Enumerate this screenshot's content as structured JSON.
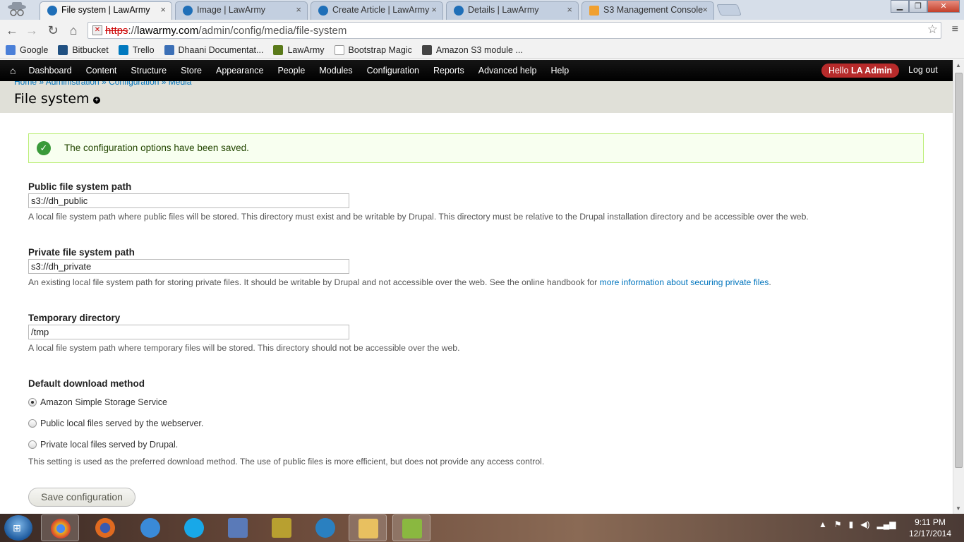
{
  "browser": {
    "tabs": [
      {
        "title": "File system | LawArmy",
        "active": true,
        "icon": "drupal-icon"
      },
      {
        "title": "Image | LawArmy",
        "active": false,
        "icon": "drupal-icon"
      },
      {
        "title": "Create Article | LawArmy",
        "active": false,
        "icon": "drupal-icon"
      },
      {
        "title": "Details | LawArmy",
        "active": false,
        "icon": "drupal-icon"
      },
      {
        "title": "S3 Management Console",
        "active": false,
        "icon": "aws-icon"
      }
    ],
    "close_glyph": "×",
    "window_buttons": {
      "minimize": "▁",
      "maximize": "❐",
      "close": "✕"
    },
    "nav": {
      "back": "←",
      "forward": "→",
      "reload": "↻",
      "home": "⌂",
      "star": "☆",
      "menu": "≡"
    },
    "url": {
      "warning_glyph": "✕",
      "scheme": "https",
      "rest_prefix": "://",
      "host": "lawarmy.com",
      "path": "/admin/config/media/file-system"
    },
    "bookmarks": [
      {
        "label": "Google",
        "icon": "google-icon",
        "color": "#4a7fd8"
      },
      {
        "label": "Bitbucket",
        "icon": "bitbucket-icon",
        "color": "#205081"
      },
      {
        "label": "Trello",
        "icon": "trello-icon",
        "color": "#0079bf"
      },
      {
        "label": "Dhaani Documentat...",
        "icon": "doc-icon",
        "color": "#3b6fb6"
      },
      {
        "label": "LawArmy",
        "icon": "lawarmy-icon",
        "color": "#5a7a1a"
      },
      {
        "label": "Bootstrap Magic",
        "icon": "page-icon",
        "color": "#dddddd"
      },
      {
        "label": "Amazon S3 module ...",
        "icon": "amazon-icon",
        "color": "#444444"
      }
    ]
  },
  "admin": {
    "home_glyph": "⌂",
    "menu": [
      "Dashboard",
      "Content",
      "Structure",
      "Store",
      "Appearance",
      "People",
      "Modules",
      "Configuration",
      "Reports",
      "Advanced help",
      "Help"
    ],
    "hello_prefix": "Hello ",
    "user": "LA Admin",
    "logout": "Log out"
  },
  "page": {
    "breadcrumb": "Home » Administration » Configuration » Media",
    "title": "File system",
    "shortcut_glyph": "+",
    "message": "The configuration options have been saved.",
    "message_glyph": "✓",
    "fields": {
      "public": {
        "label": "Public file system path",
        "value": "s3://dh_public",
        "description": "A local file system path where public files will be stored. This directory must exist and be writable by Drupal. This directory must be relative to the Drupal installation directory and be accessible over the web."
      },
      "private": {
        "label": "Private file system path",
        "value": "s3://dh_private",
        "description_prefix": "An existing local file system path for storing private files. It should be writable by Drupal and not accessible over the web. See the online handbook for ",
        "description_link": "more information about securing private files",
        "description_suffix": "."
      },
      "temporary": {
        "label": "Temporary directory",
        "value": "/tmp",
        "description": "A local file system path where temporary files will be stored. This directory should not be accessible over the web."
      }
    },
    "download_method": {
      "label": "Default download method",
      "options": [
        {
          "label": "Amazon Simple Storage Service",
          "checked": true
        },
        {
          "label": "Public local files served by the webserver.",
          "checked": false
        },
        {
          "label": "Private local files served by Drupal.",
          "checked": false
        }
      ],
      "description": "This setting is used as the preferred download method. The use of public files is more efficient, but does not provide any access control."
    },
    "save_button": "Save configuration"
  },
  "scrollbar": {
    "up": "▲",
    "down": "▼"
  },
  "taskbar": {
    "start_glyph": "⊞",
    "items": [
      {
        "name": "chrome-icon",
        "color": "#e8b020",
        "active": true
      },
      {
        "name": "firefox-icon",
        "color": "#e06a20",
        "active": false
      },
      {
        "name": "ie-icon",
        "color": "#3a8ad8",
        "active": false
      },
      {
        "name": "skype-icon",
        "color": "#18a8e8",
        "active": false
      },
      {
        "name": "network-tool-icon",
        "color": "#5a7ab8",
        "active": false
      },
      {
        "name": "ftp-tool-icon",
        "color": "#b8a030",
        "active": false
      },
      {
        "name": "sourcetree-icon",
        "color": "#2a80c0",
        "active": false
      },
      {
        "name": "explorer-icon",
        "color": "#e8c060",
        "active": true
      },
      {
        "name": "notepad-icon",
        "color": "#8ab840",
        "active": true
      }
    ],
    "tray": [
      "▲",
      "⚑",
      "▮",
      "◀)",
      "▂▄▆"
    ],
    "time": "9:11 PM",
    "date": "12/17/2014"
  }
}
